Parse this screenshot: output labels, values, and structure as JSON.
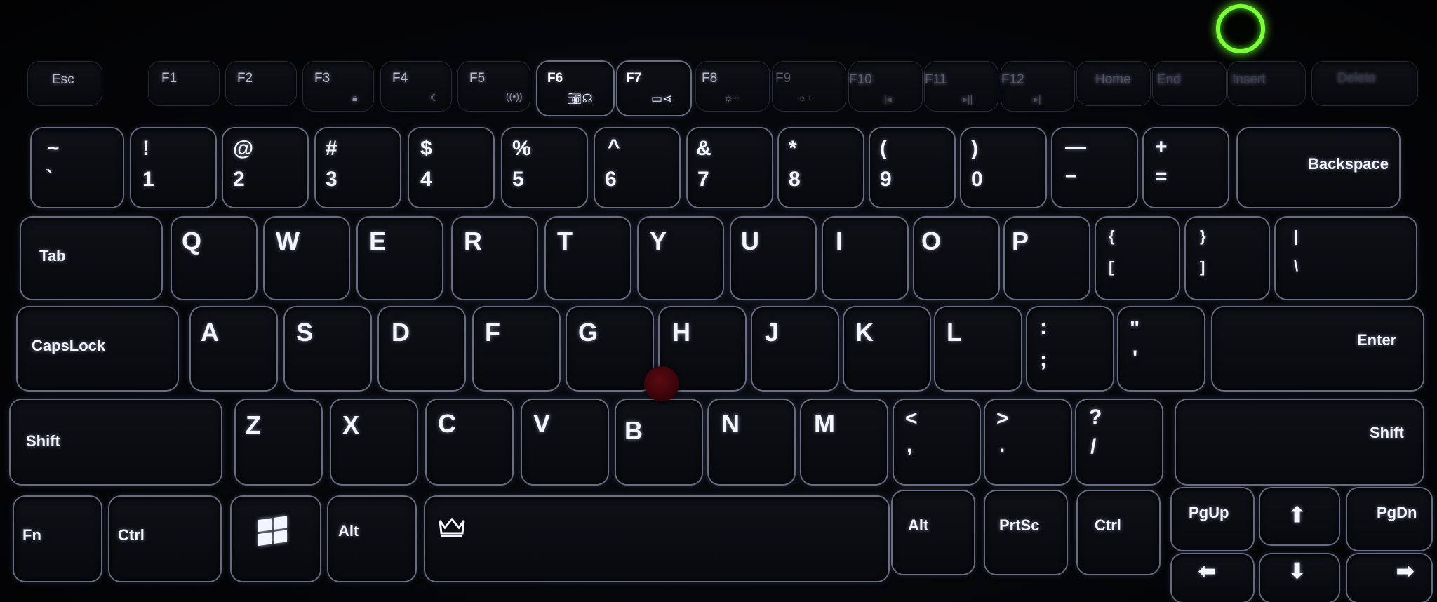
{
  "function_row": {
    "esc": "Esc",
    "f1": "F1",
    "f2": "F2",
    "f3": "F3",
    "f3_icon": "lock-icon",
    "f4": "F4",
    "f4_icon": "moon-icon",
    "f5": "F5",
    "f5_icon": "wireless-icon",
    "f6": "F6",
    "f6_icon": "camera-headset-icon",
    "f7": "F7",
    "f7_icon": "display-switch-icon",
    "f8": "F8",
    "f8_icon": "brightness-down-icon",
    "f9": "F9",
    "f9_icon": "brightness-up-icon",
    "f10": "F10",
    "f10_icon": "previous-track-icon",
    "f11": "F11",
    "f11_icon": "play-pause-icon",
    "f12": "F12",
    "f12_icon": "next-track-icon",
    "home": "Home",
    "end": "End",
    "insert": "Insert",
    "delete": "Delete"
  },
  "number_row": [
    {
      "top": "~",
      "bottom": "`"
    },
    {
      "top": "!",
      "bottom": "1"
    },
    {
      "top": "@",
      "bottom": "2"
    },
    {
      "top": "#",
      "bottom": "3"
    },
    {
      "top": "$",
      "bottom": "4"
    },
    {
      "top": "%",
      "bottom": "5"
    },
    {
      "top": "^",
      "bottom": "6"
    },
    {
      "top": "&",
      "bottom": "7"
    },
    {
      "top": "*",
      "bottom": "8"
    },
    {
      "top": "(",
      "bottom": "9"
    },
    {
      "top": ")",
      "bottom": "0"
    },
    {
      "top": "—",
      "bottom": "–"
    },
    {
      "top": "+",
      "bottom": "="
    }
  ],
  "backspace": "Backspace",
  "tab": "Tab",
  "qwerty_row": [
    "Q",
    "W",
    "E",
    "R",
    "T",
    "Y",
    "U",
    "I",
    "O",
    "P"
  ],
  "bracket_keys": [
    {
      "top": "{",
      "bottom": "["
    },
    {
      "top": "}",
      "bottom": "]"
    },
    {
      "top": "|",
      "bottom": "\\"
    }
  ],
  "capslock": "CapsLock",
  "home_row": [
    "A",
    "S",
    "D",
    "F",
    "G",
    "H",
    "J",
    "K",
    "L"
  ],
  "home_punct": [
    {
      "top": ":",
      "bottom": ";"
    },
    {
      "top": "\"",
      "bottom": "'"
    }
  ],
  "enter": "Enter",
  "shift_left": "Shift",
  "bottom_letters": [
    "Z",
    "X",
    "C",
    "V",
    "B",
    "N",
    "M"
  ],
  "bottom_punct": [
    {
      "top": "<",
      "bottom": ","
    },
    {
      "top": ">",
      "bottom": "."
    },
    {
      "top": "?",
      "bottom": "/"
    }
  ],
  "shift_right": "Shift",
  "modifiers": {
    "fn": "Fn",
    "ctrl_left": "Ctrl",
    "windows_icon": "windows-logo-icon",
    "alt_left": "Alt",
    "thinkvantage_icon": "crown-icon",
    "alt_right": "Alt",
    "prtsc": "PrtSc",
    "ctrl_right": "Ctrl",
    "pgup": "PgUp",
    "pgdn": "PgDn"
  },
  "arrows": {
    "up": "up-arrow-icon",
    "down": "down-arrow-icon",
    "left": "left-arrow-icon",
    "right": "right-arrow-icon"
  },
  "colors": {
    "backlight": "#c8d0ff",
    "power_led": "#7cff3a",
    "trackpoint": "#5c0a12"
  }
}
